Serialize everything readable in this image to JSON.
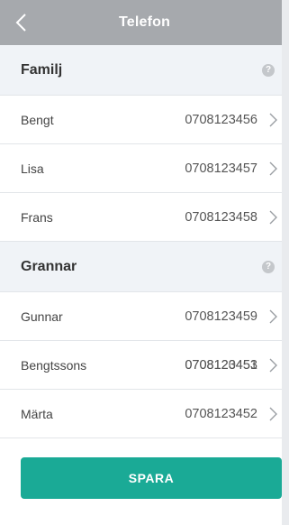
{
  "header": {
    "title": "Telefon",
    "back_icon": "chevron-left-icon"
  },
  "sections": [
    {
      "title": "Familj",
      "help_glyph": "?",
      "contacts": [
        {
          "name": "Bengt",
          "number": "0708123456"
        },
        {
          "name": "Lisa",
          "number": "0708123457"
        },
        {
          "name": "Frans",
          "number": "0708123458"
        }
      ]
    },
    {
      "title": "Grannar",
      "help_glyph": "?",
      "contacts": [
        {
          "name": "Gunnar",
          "number": "0708123459"
        },
        {
          "name": "Bengtssons",
          "number": "0708123453",
          "number_overlay": "0708120451"
        },
        {
          "name": "Märta",
          "number": "0708123452"
        }
      ]
    }
  ],
  "save_button": {
    "label": "SPARA",
    "color": "#1aaa96"
  },
  "colors": {
    "header_bg": "#a6a9ad",
    "section_bg": "#f0f3f7"
  }
}
